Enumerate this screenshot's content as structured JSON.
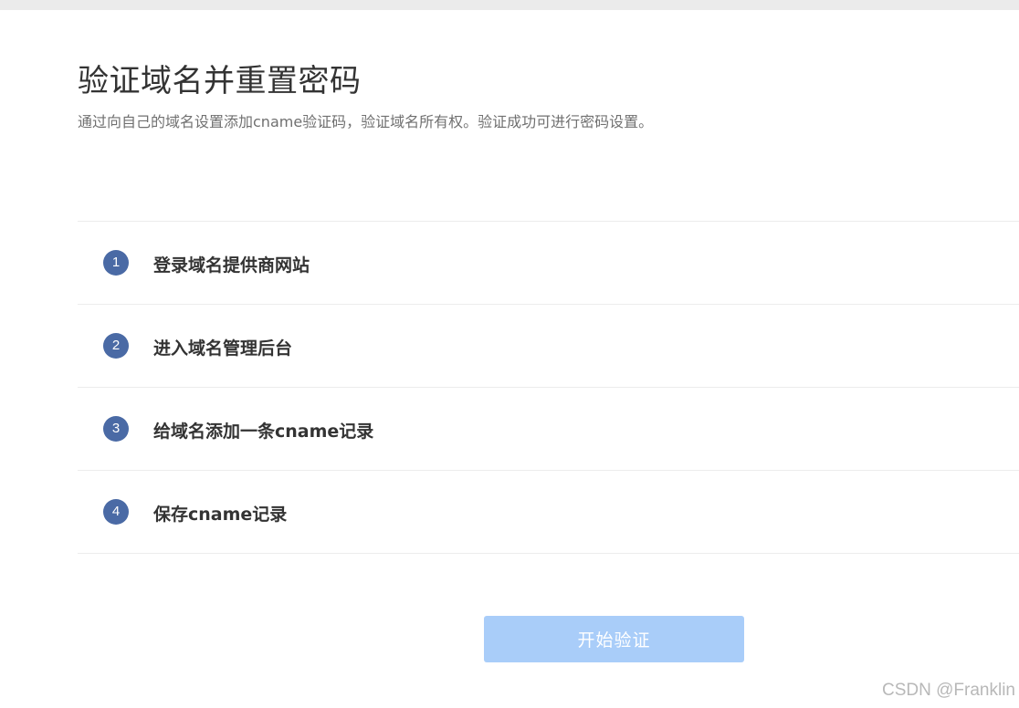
{
  "page": {
    "title": "验证域名并重置密码",
    "subtitle": "通过向自己的域名设置添加cname验证码，验证域名所有权。验证成功可进行密码设置。"
  },
  "steps": [
    {
      "number": "1",
      "label": "登录域名提供商网站"
    },
    {
      "number": "2",
      "label": "进入域名管理后台"
    },
    {
      "number": "3",
      "label": "给域名添加一条cname记录"
    },
    {
      "number": "4",
      "label": "保存cname记录"
    }
  ],
  "actions": {
    "start_label": "开始验证"
  },
  "watermark": "CSDN @Franklin",
  "colors": {
    "step_badge": "#4a6aa5",
    "button_disabled": "#a9cdf9",
    "divider": "#ececec"
  }
}
